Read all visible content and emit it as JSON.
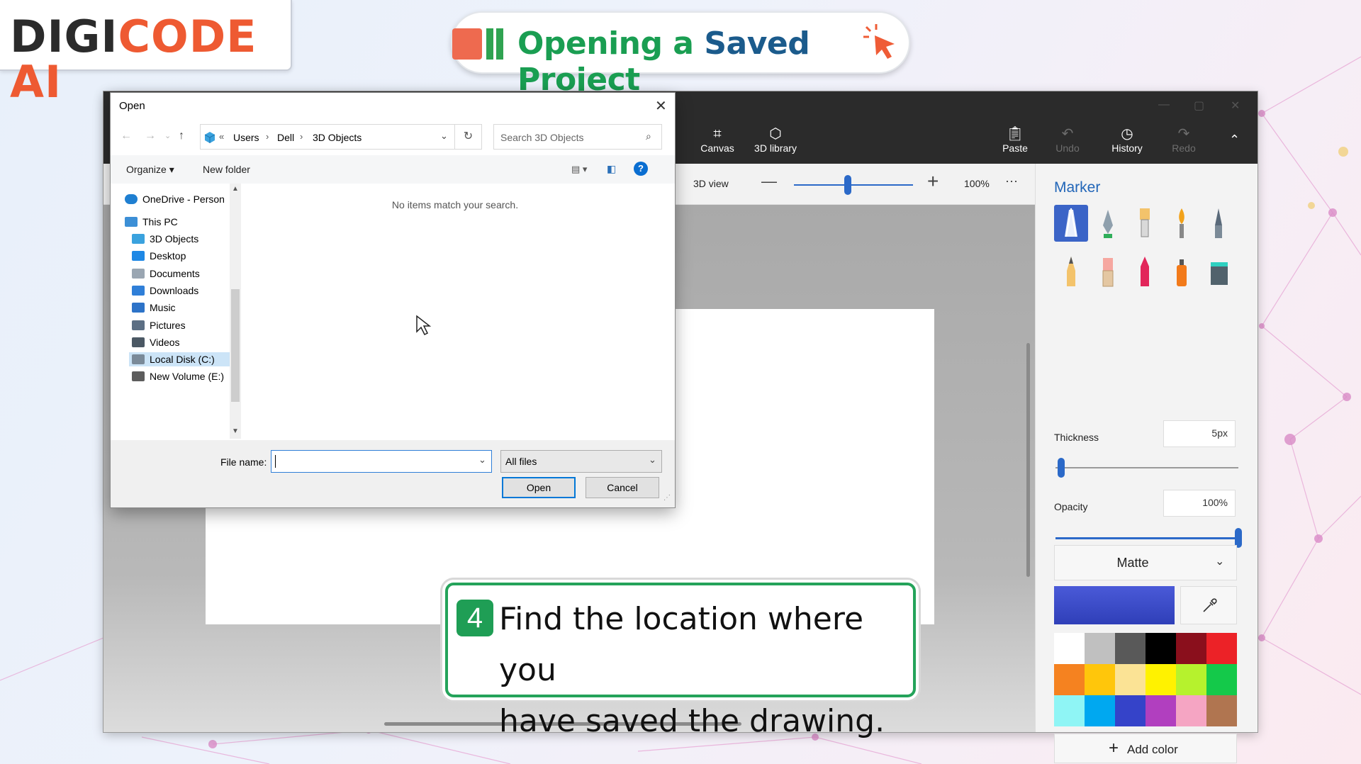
{
  "brand": {
    "logo_part1": "DIGI",
    "logo_part2": "CODE AI"
  },
  "title": {
    "part1": "Opening a",
    "part2": "Saved",
    "part3": "Project"
  },
  "paint": {
    "toolbar": [
      {
        "label": "Canvas",
        "icon": "crop-icon",
        "enabled": true
      },
      {
        "label": "3D library",
        "icon": "cube-library-icon",
        "enabled": true
      },
      {
        "label": "Paste",
        "icon": "clipboard-icon",
        "enabled": true
      },
      {
        "label": "Undo",
        "icon": "undo-icon",
        "enabled": false
      },
      {
        "label": "History",
        "icon": "history-icon",
        "enabled": true
      },
      {
        "label": "Redo",
        "icon": "redo-icon",
        "enabled": false
      }
    ],
    "view_label": "3D view",
    "zoom_value": "100%",
    "zoom_fraction": 0.45,
    "more": "···"
  },
  "panel": {
    "title": "Marker",
    "tools": [
      "marker-icon",
      "calligraphy-pen-icon",
      "oil-brush-icon",
      "watercolor-icon",
      "pixel-pen-icon",
      "pencil-icon",
      "eraser-icon",
      "crayon-icon",
      "spray-can-icon",
      "fill-bucket-icon"
    ],
    "thickness_label": "Thickness",
    "thickness_value": "5px",
    "thickness_fraction": 0.03,
    "opacity_label": "Opacity",
    "opacity_value": "100%",
    "opacity_fraction": 1.0,
    "finish": "Matte",
    "selected_color": "#2f3fb8",
    "palette": [
      "#ffffff",
      "#c0c0c0",
      "#595959",
      "#000000",
      "#8a0f1c",
      "#ec2227",
      "#f58220",
      "#ffc60b",
      "#fbe395",
      "#fff200",
      "#b6f22d",
      "#14c94a",
      "#8ff5f5",
      "#00a8f0",
      "#3543c9",
      "#b13fbf",
      "#f5a5c3",
      "#b07550"
    ],
    "add_color": "Add color"
  },
  "dialog": {
    "title": "Open",
    "breadcrumb": [
      "«",
      "Users",
      "Dell",
      "3D Objects"
    ],
    "search_placeholder": "Search 3D Objects",
    "organize": "Organize ▾",
    "new_folder": "New folder",
    "nav": [
      {
        "label": "OneDrive - Person",
        "icon": "cloud-icon"
      },
      {
        "label": "This PC",
        "icon": "computer-icon"
      },
      {
        "label": "3D Objects",
        "icon": "cube-icon"
      },
      {
        "label": "Desktop",
        "icon": "desktop-icon"
      },
      {
        "label": "Documents",
        "icon": "document-icon"
      },
      {
        "label": "Downloads",
        "icon": "download-icon"
      },
      {
        "label": "Music",
        "icon": "music-icon"
      },
      {
        "label": "Pictures",
        "icon": "picture-icon"
      },
      {
        "label": "Videos",
        "icon": "video-icon"
      },
      {
        "label": "Local Disk (C:)",
        "icon": "disk-icon"
      },
      {
        "label": "New Volume (E:)",
        "icon": "drive-icon"
      }
    ],
    "empty_message": "No items match your search.",
    "file_name_label": "File name:",
    "file_name_value": "",
    "filter": "All files",
    "open_btn": "Open",
    "cancel_btn": "Cancel"
  },
  "step": {
    "number": "4",
    "line1": "Find the location where you",
    "line2": "have saved the drawing."
  }
}
